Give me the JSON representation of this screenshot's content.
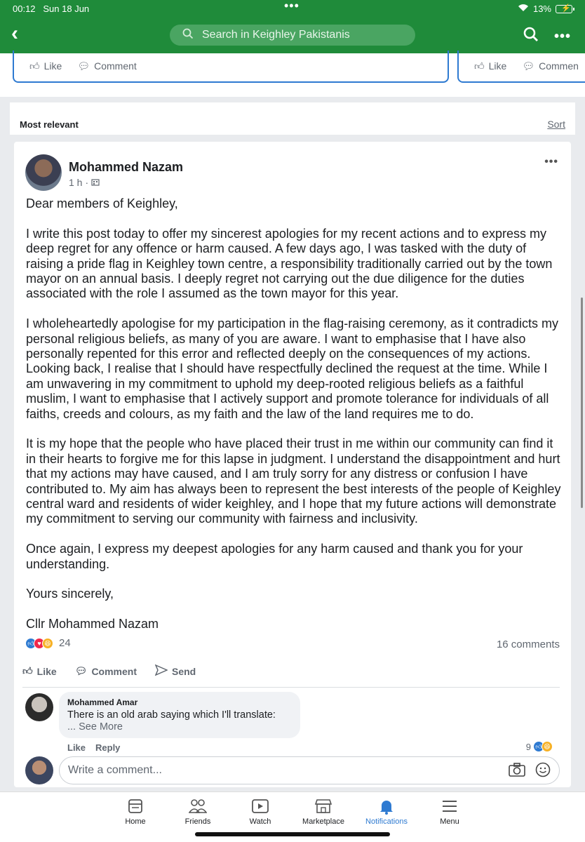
{
  "status_bar": {
    "time": "00:12",
    "date": "Sun 18 Jun",
    "battery": "13%"
  },
  "header": {
    "back_icon": "chevron-left-icon",
    "search_placeholder": "Search in Keighley Pakistanis",
    "accent_color": "#1f8b3a"
  },
  "prev_cards": [
    {
      "like": "Like",
      "comment": "Comment"
    },
    {
      "like": "Like",
      "comment": "Commen"
    }
  ],
  "sort_bar": {
    "label": "Most relevant",
    "sort": "Sort"
  },
  "post": {
    "author": "Mohammed Nazam",
    "time": "1 h",
    "paragraphs": [
      "Dear members of Keighley,",
      "I write this post today to offer my sincerest apologies for my recent actions and to express my deep regret for any offence or harm caused. A few days ago, I was tasked with the duty of raising a pride flag in Keighley town centre, a responsibility traditionally carried out by the town mayor on an annual basis. I deeply regret not carrying out the due diligence for  the duties associated with the role I assumed as the town mayor for this year.",
      "I wholeheartedly apologise for my participation in the flag-raising ceremony, as it contradicts my personal religious beliefs, as many of you are aware. I want to emphasise that I have also personally repented for this error and reflected deeply on the consequences of my actions. Looking back, I realise that I should have respectfully declined the request at the time. While I am unwavering in my commitment to uphold my deep-rooted religious beliefs as a faithful muslim, I want to emphasise that I actively support and promote tolerance for individuals of all faiths, creeds and colours, as my faith and the law of the land requires me to do.",
      "It is my hope that the people who have placed their trust in me within our community can find it in their hearts to forgive me for this lapse in judgment. I understand the disappointment and hurt that my actions may have caused, and I am truly sorry for any distress or confusion I have contributed to. My aim has always been to represent the best interests of the people of Keighley central ward and residents of wider keighley, and I hope that my future actions will demonstrate my commitment to serving our community with fairness and inclusivity.",
      "Once again, I express my deepest apologies for any harm caused and thank you for your understanding.",
      "Yours sincerely,",
      "Cllr Mohammed Nazam"
    ],
    "reaction_count": "24",
    "comments_count": "16 comments",
    "actions": {
      "like": "Like",
      "comment": "Comment",
      "send": "Send"
    }
  },
  "comment": {
    "author": "Mohammed Amar",
    "text": "There is an old arab saying which I'll translate:",
    "see_more": "... See More",
    "like": "Like",
    "reply": "Reply",
    "reaction_count": "9"
  },
  "write_comment": {
    "placeholder": "Write a comment..."
  },
  "tabs": [
    {
      "label": "Home",
      "icon": "home-icon"
    },
    {
      "label": "Friends",
      "icon": "friends-icon"
    },
    {
      "label": "Watch",
      "icon": "watch-icon"
    },
    {
      "label": "Marketplace",
      "icon": "marketplace-icon"
    },
    {
      "label": "Notifications",
      "icon": "bell-icon",
      "active": true
    },
    {
      "label": "Menu",
      "icon": "menu-icon"
    }
  ]
}
